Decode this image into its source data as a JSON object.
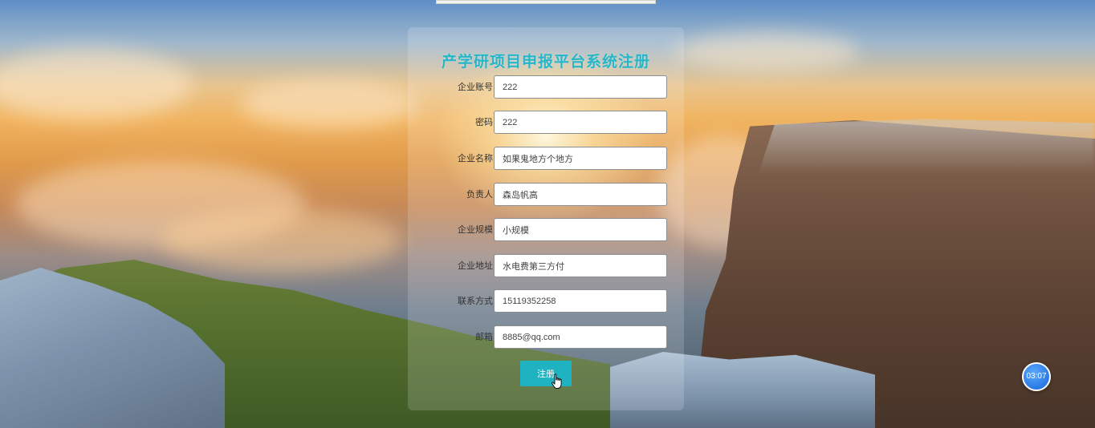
{
  "form": {
    "title": "产学研项目申报平台系统注册",
    "fields": [
      {
        "label": "企业账号",
        "value": "222"
      },
      {
        "label": "密码",
        "value": "222"
      },
      {
        "label": "企业名称",
        "value": "如果鬼地方个地方"
      },
      {
        "label": "负责人",
        "value": "森岛帆高"
      },
      {
        "label": "企业规模",
        "value": "小规模"
      },
      {
        "label": "企业地址",
        "value": "水电费第三方付"
      },
      {
        "label": "联系方式",
        "value": "15119352258"
      },
      {
        "label": "邮箱",
        "value": "8885@qq.com"
      }
    ],
    "submit_label": "注册"
  },
  "timer": {
    "text": "03:07"
  },
  "icons": {
    "cursor": "hand-pointer-icon"
  },
  "colors": {
    "accent": "#1fb3c2",
    "title": "#25b6c9",
    "timer": "#1665d8"
  }
}
